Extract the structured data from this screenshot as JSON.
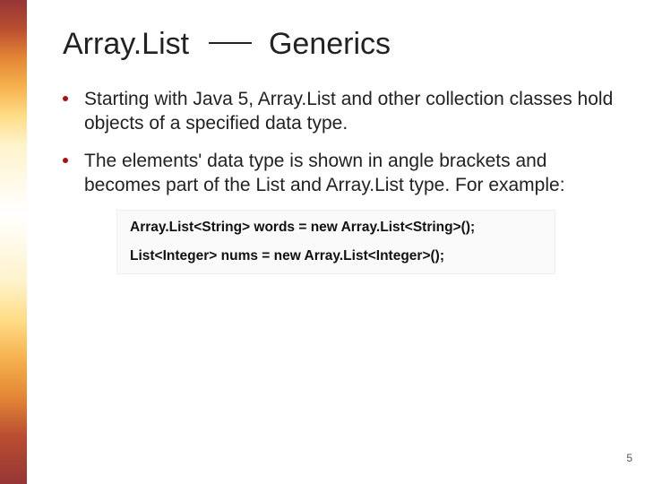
{
  "slide": {
    "title_part1": "Array.List",
    "title_part2": "Generics",
    "bullets": [
      "Starting with Java 5, Array.List and other collection classes hold objects of a specified data type.",
      "The elements' data type is shown in angle brackets and becomes part of the List and Array.List type.  For example:"
    ],
    "code_lines": [
      "Array.List<String> words = new Array.List<String>();",
      "List<Integer> nums = new Array.List<Integer>();"
    ],
    "page_number": "5"
  }
}
